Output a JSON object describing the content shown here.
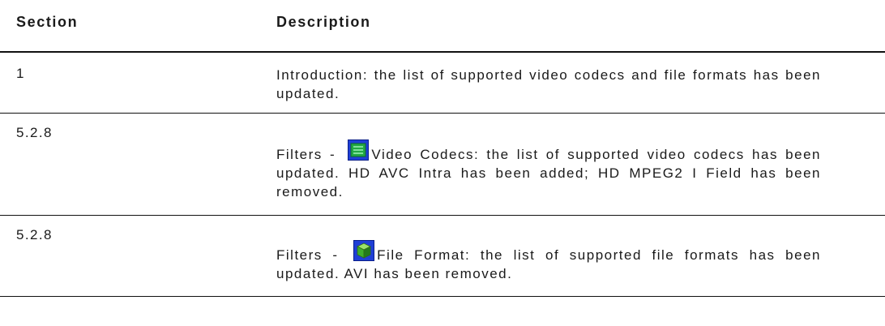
{
  "table": {
    "headers": {
      "section": "Section",
      "description": "Description"
    },
    "rows": [
      {
        "section": "1",
        "description": "Introduction: the list of supported video codecs and file formats has been updated."
      },
      {
        "section": "5.2.8",
        "description_prefix": "Filters - ",
        "icon": "video-codecs-icon",
        "description_suffix": "Video Codecs: the list of supported video codecs has been updated. HD AVC Intra has been added; HD MPEG2 I Field has been removed."
      },
      {
        "section": "5.2.8",
        "description_prefix": "Filters - ",
        "icon": "file-format-cube-icon",
        "description_suffix": "File Format: the list of supported file formats has been updated. AVI has been removed."
      }
    ]
  },
  "colors": {
    "text": "#1a1a1a",
    "rule": "#111111",
    "icon_blue": "#1f3fd6",
    "icon_green": "#2aa84a"
  }
}
